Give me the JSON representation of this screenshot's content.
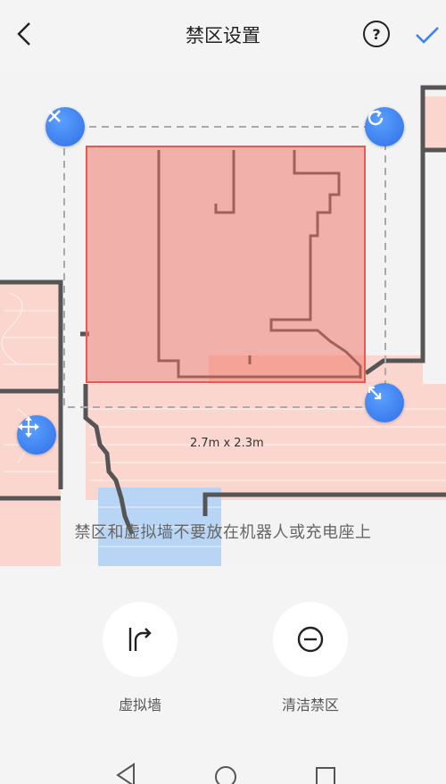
{
  "header": {
    "title": "禁区设置",
    "help_label": "?"
  },
  "map": {
    "dimensions": "2.7m x 2.3m",
    "hint": "禁区和虚拟墙不要放在机器人或充电座上"
  },
  "tools": [
    {
      "label": "虚拟墙",
      "icon": "virtual-wall-icon"
    },
    {
      "label": "清洁禁区",
      "icon": "no-go-zone-icon"
    }
  ],
  "colors": {
    "accent": "#3d82f0",
    "zone": "#f7b2a8",
    "zone_border": "#e85a4f",
    "wall": "#555555",
    "floor": "#fbd6cf",
    "water": "#b9d5f5"
  }
}
